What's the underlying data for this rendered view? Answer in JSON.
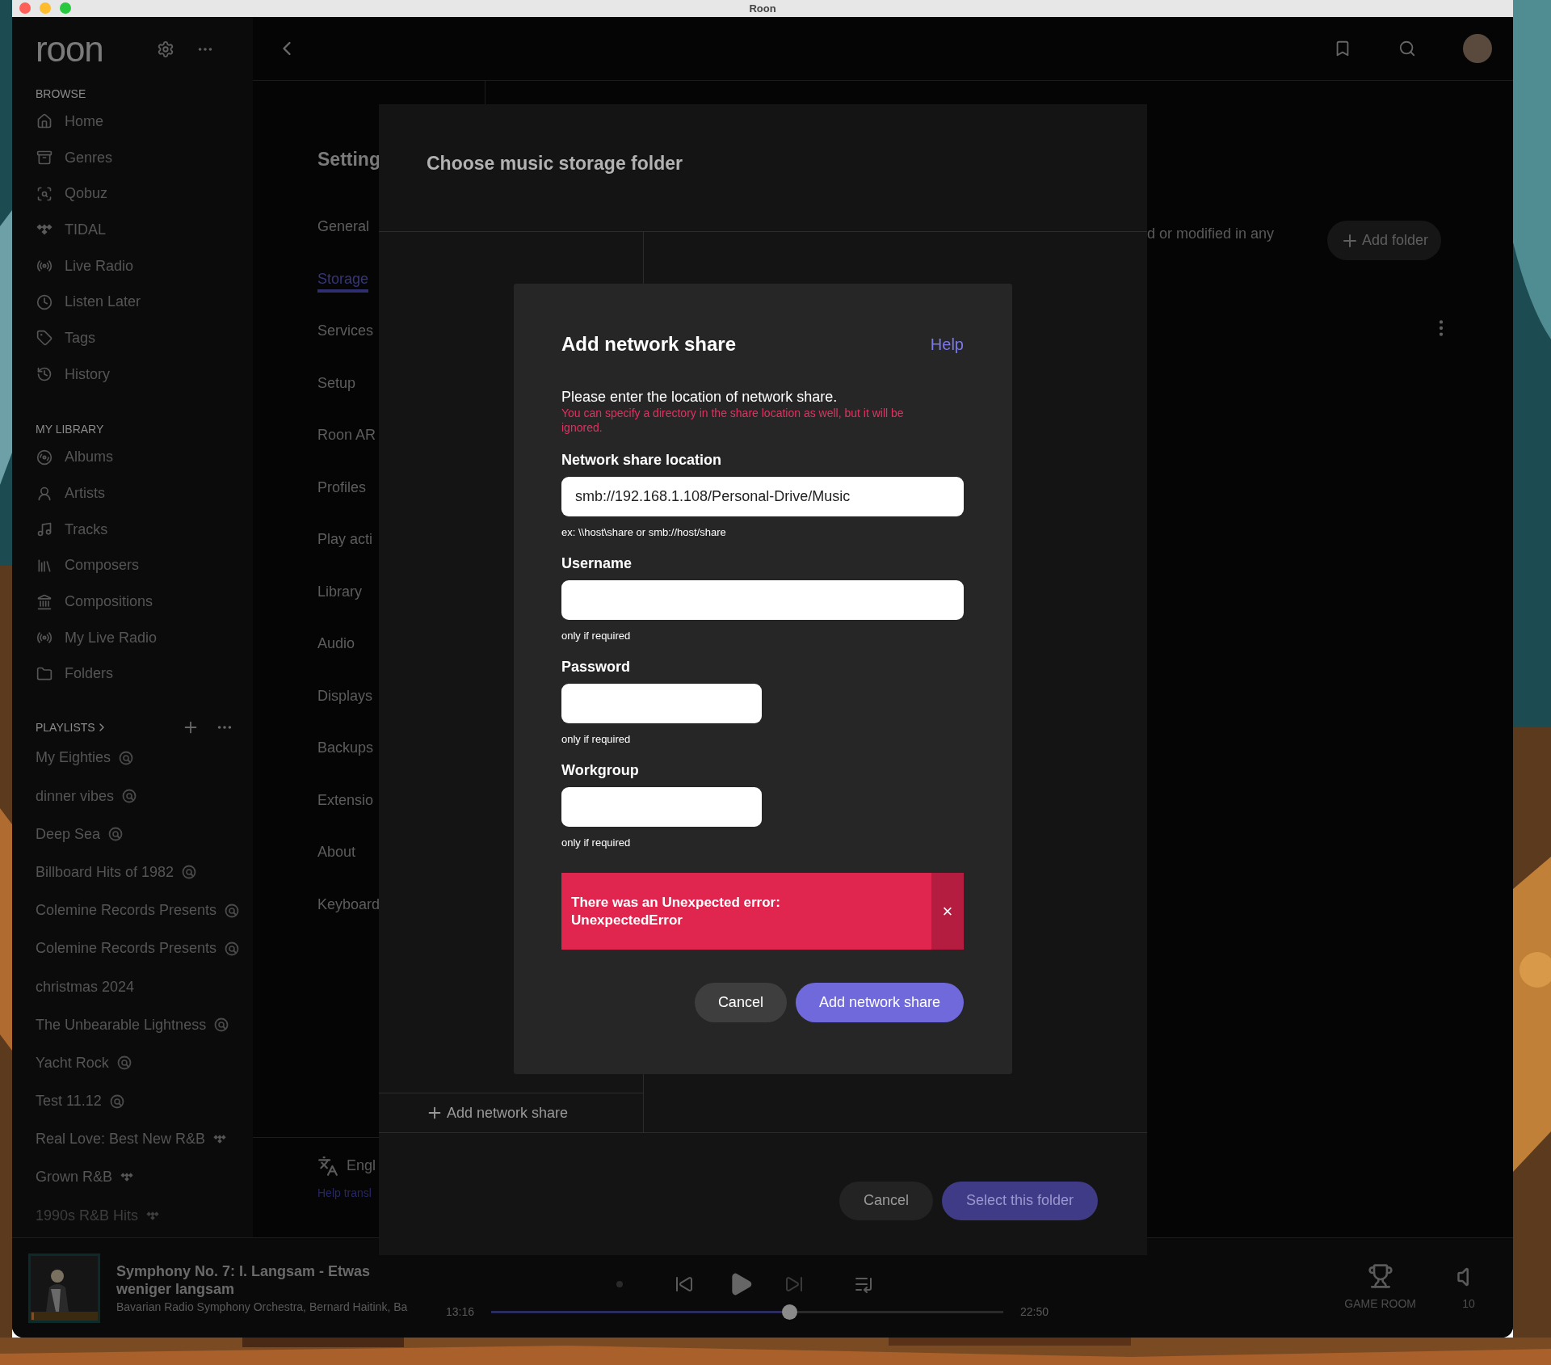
{
  "window": {
    "title": "Roon"
  },
  "sidebar": {
    "logo": "roon",
    "sections": [
      {
        "heading": "BROWSE",
        "items": [
          {
            "label": "Home"
          },
          {
            "label": "Genres"
          },
          {
            "label": "Qobuz"
          },
          {
            "label": "TIDAL"
          },
          {
            "label": "Live Radio"
          },
          {
            "label": "Listen Later"
          },
          {
            "label": "Tags"
          },
          {
            "label": "History"
          }
        ]
      },
      {
        "heading": "MY LIBRARY",
        "items": [
          {
            "label": "Albums"
          },
          {
            "label": "Artists"
          },
          {
            "label": "Tracks"
          },
          {
            "label": "Composers"
          },
          {
            "label": "Compositions"
          },
          {
            "label": "My Live Radio"
          },
          {
            "label": "Folders"
          }
        ]
      }
    ],
    "playlists": {
      "heading": "PLAYLISTS",
      "items": [
        {
          "label": "My Eighties",
          "kind": "qobuz"
        },
        {
          "label": "dinner vibes",
          "kind": "qobuz"
        },
        {
          "label": "Deep Sea",
          "kind": "qobuz"
        },
        {
          "label": "Billboard Hits of 1982",
          "kind": "qobuz"
        },
        {
          "label": "Colemine Records Presents",
          "kind": "qobuz"
        },
        {
          "label": "Colemine Records Presents",
          "kind": "qobuz"
        },
        {
          "label": "christmas 2024",
          "kind": "plain"
        },
        {
          "label": "The Unbearable Lightness",
          "kind": "qobuz"
        },
        {
          "label": "Yacht Rock",
          "kind": "qobuz"
        },
        {
          "label": "Test 11.12",
          "kind": "qobuz"
        },
        {
          "label": "Real Love: Best New R&B",
          "kind": "tidal"
        },
        {
          "label": "Grown R&B",
          "kind": "tidal"
        },
        {
          "label": "1990s R&B Hits",
          "kind": "tidal"
        }
      ]
    }
  },
  "settings": {
    "title": "Setting",
    "items": [
      {
        "label": "General",
        "selected": false
      },
      {
        "label": "Storage",
        "selected": true
      },
      {
        "label": "Services",
        "selected": false
      },
      {
        "label": "Setup",
        "selected": false
      },
      {
        "label": "Roon AR",
        "selected": false
      },
      {
        "label": "Profiles",
        "selected": false
      },
      {
        "label": "Play acti",
        "selected": false
      },
      {
        "label": "Library",
        "selected": false
      },
      {
        "label": "Audio",
        "selected": false
      },
      {
        "label": "Displays",
        "selected": false
      },
      {
        "label": "Backups",
        "selected": false
      },
      {
        "label": "Extensio",
        "selected": false
      },
      {
        "label": "About",
        "selected": false
      },
      {
        "label": "Keyboard",
        "selected": false
      }
    ],
    "language": "Engl",
    "help_link": "Help transl"
  },
  "storage": {
    "description": "d or modified in any",
    "add_folder": "Add folder"
  },
  "folder_dialog": {
    "title": "Choose music storage folder",
    "add_network_share": "Add network share",
    "buttons": [
      {
        "label": "Cancel",
        "kind": "secondary"
      },
      {
        "label": "Select this folder",
        "kind": "primary"
      }
    ]
  },
  "share_dialog": {
    "title": "Add network share",
    "help": "Help",
    "intro": "Please enter the location of network share.",
    "warning": "You can specify a directory in the share location as well, but it will be ignored.",
    "fields": [
      {
        "label": "Network share location",
        "value": "smb://192.168.1.108/Personal-Drive/Music",
        "hint": "ex: \\\\host\\share or smb://host/share",
        "kind": "wide"
      },
      {
        "label": "Username",
        "hint": "only if required",
        "kind": "wide"
      },
      {
        "label": "Password",
        "hint": "only if required",
        "kind": "narrow"
      },
      {
        "label": "Workgroup",
        "hint": "only if required",
        "kind": "narrow"
      }
    ],
    "error": {
      "message": "There was an Unexpected error:\nUnexpectedError",
      "close": "×"
    },
    "buttons": [
      {
        "label": "Cancel",
        "kind": "secondary"
      },
      {
        "label": "Add network share",
        "kind": "primary"
      }
    ]
  },
  "player": {
    "title": "Symphony No. 7: I. Langsam - Etwas weniger langsam",
    "artists": "Bavarian Radio Symphony Orchestra, Bernard Haitink, Ba",
    "elapsed": "13:16",
    "duration": "22:50",
    "level": 0.586,
    "zone": "GAME ROOM",
    "volume": "10"
  }
}
